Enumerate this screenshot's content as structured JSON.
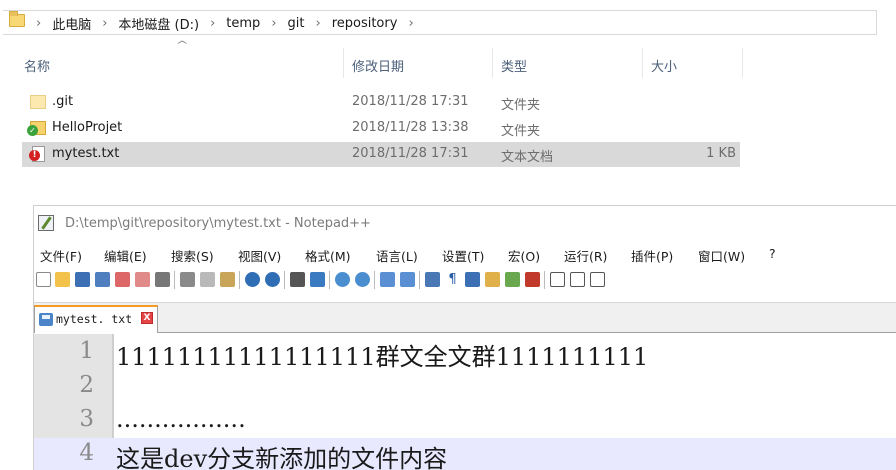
{
  "explorer": {
    "breadcrumb": [
      "此电脑",
      "本地磁盘 (D:)",
      "temp",
      "git",
      "repository"
    ],
    "columns": {
      "name": "名称",
      "date": "修改日期",
      "type": "类型",
      "size": "大小"
    },
    "files": [
      {
        "name": ".git",
        "date": "2018/11/28 17:31",
        "type": "文件夹",
        "size": "",
        "icon": "folder-icon"
      },
      {
        "name": "HelloProjet",
        "date": "2018/11/28 13:38",
        "type": "文件夹",
        "size": "",
        "icon": "git-clean-folder-icon"
      },
      {
        "name": "mytest.txt",
        "date": "2018/11/28 17:31",
        "type": "文本文档",
        "size": "1 KB",
        "icon": "git-modified-file-icon"
      }
    ]
  },
  "notepad": {
    "title": "D:\\temp\\git\\repository\\mytest.txt - Notepad++",
    "menu": [
      "文件(F)",
      "编辑(E)",
      "搜索(S)",
      "视图(V)",
      "格式(M)",
      "语言(L)",
      "设置(T)",
      "宏(O)",
      "运行(R)",
      "插件(P)",
      "窗口(W)",
      "?"
    ],
    "tab": {
      "label": "mytest. txt",
      "close": "X"
    },
    "lines": [
      {
        "num": "1",
        "text": "11111111111111111群文全文群1111111111"
      },
      {
        "num": "2",
        "text": ""
      },
      {
        "num": "3",
        "text": "................."
      },
      {
        "num": "4",
        "text": "这是dev分支新添加的文件内容"
      }
    ],
    "colors": {
      "tab_accent": "#f59a23",
      "current_line": "#e8e8ff"
    }
  }
}
